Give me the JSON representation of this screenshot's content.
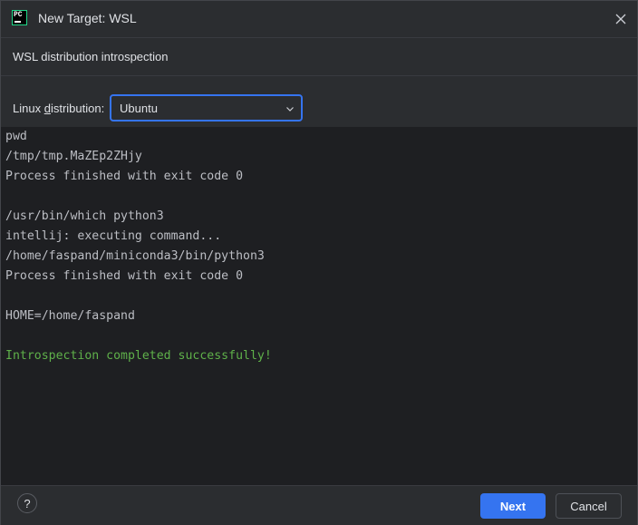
{
  "window": {
    "title": "New Target: WSL",
    "icon": "pycharm-app-icon",
    "icon_text": "PC"
  },
  "section": {
    "title": "WSL distribution introspection"
  },
  "distribution": {
    "label_prefix": "Linux ",
    "label_mnemonic": "d",
    "label_suffix": "istribution:",
    "selected": "Ubuntu"
  },
  "console": {
    "lines": [
      {
        "text": "pwd",
        "kind": "normal"
      },
      {
        "text": "/tmp/tmp.MaZEp2ZHjy",
        "kind": "normal"
      },
      {
        "text": "Process finished with exit code 0",
        "kind": "normal"
      },
      {
        "text": "",
        "kind": "normal"
      },
      {
        "text": "/usr/bin/which python3",
        "kind": "normal"
      },
      {
        "text": "intellij: executing command...",
        "kind": "normal"
      },
      {
        "text": "/home/faspand/miniconda3/bin/python3",
        "kind": "normal"
      },
      {
        "text": "Process finished with exit code 0",
        "kind": "normal"
      },
      {
        "text": "",
        "kind": "normal"
      },
      {
        "text": "HOME=/home/faspand",
        "kind": "normal"
      },
      {
        "text": "",
        "kind": "normal"
      },
      {
        "text": "Introspection completed successfully!",
        "kind": "success"
      }
    ]
  },
  "footer": {
    "help": "?",
    "next_label": "Next",
    "cancel_label": "Cancel"
  },
  "colors": {
    "accent": "#3574f0",
    "success": "#5fb14a",
    "console_bg": "#1e1f22",
    "dialog_bg": "#2b2d30"
  }
}
